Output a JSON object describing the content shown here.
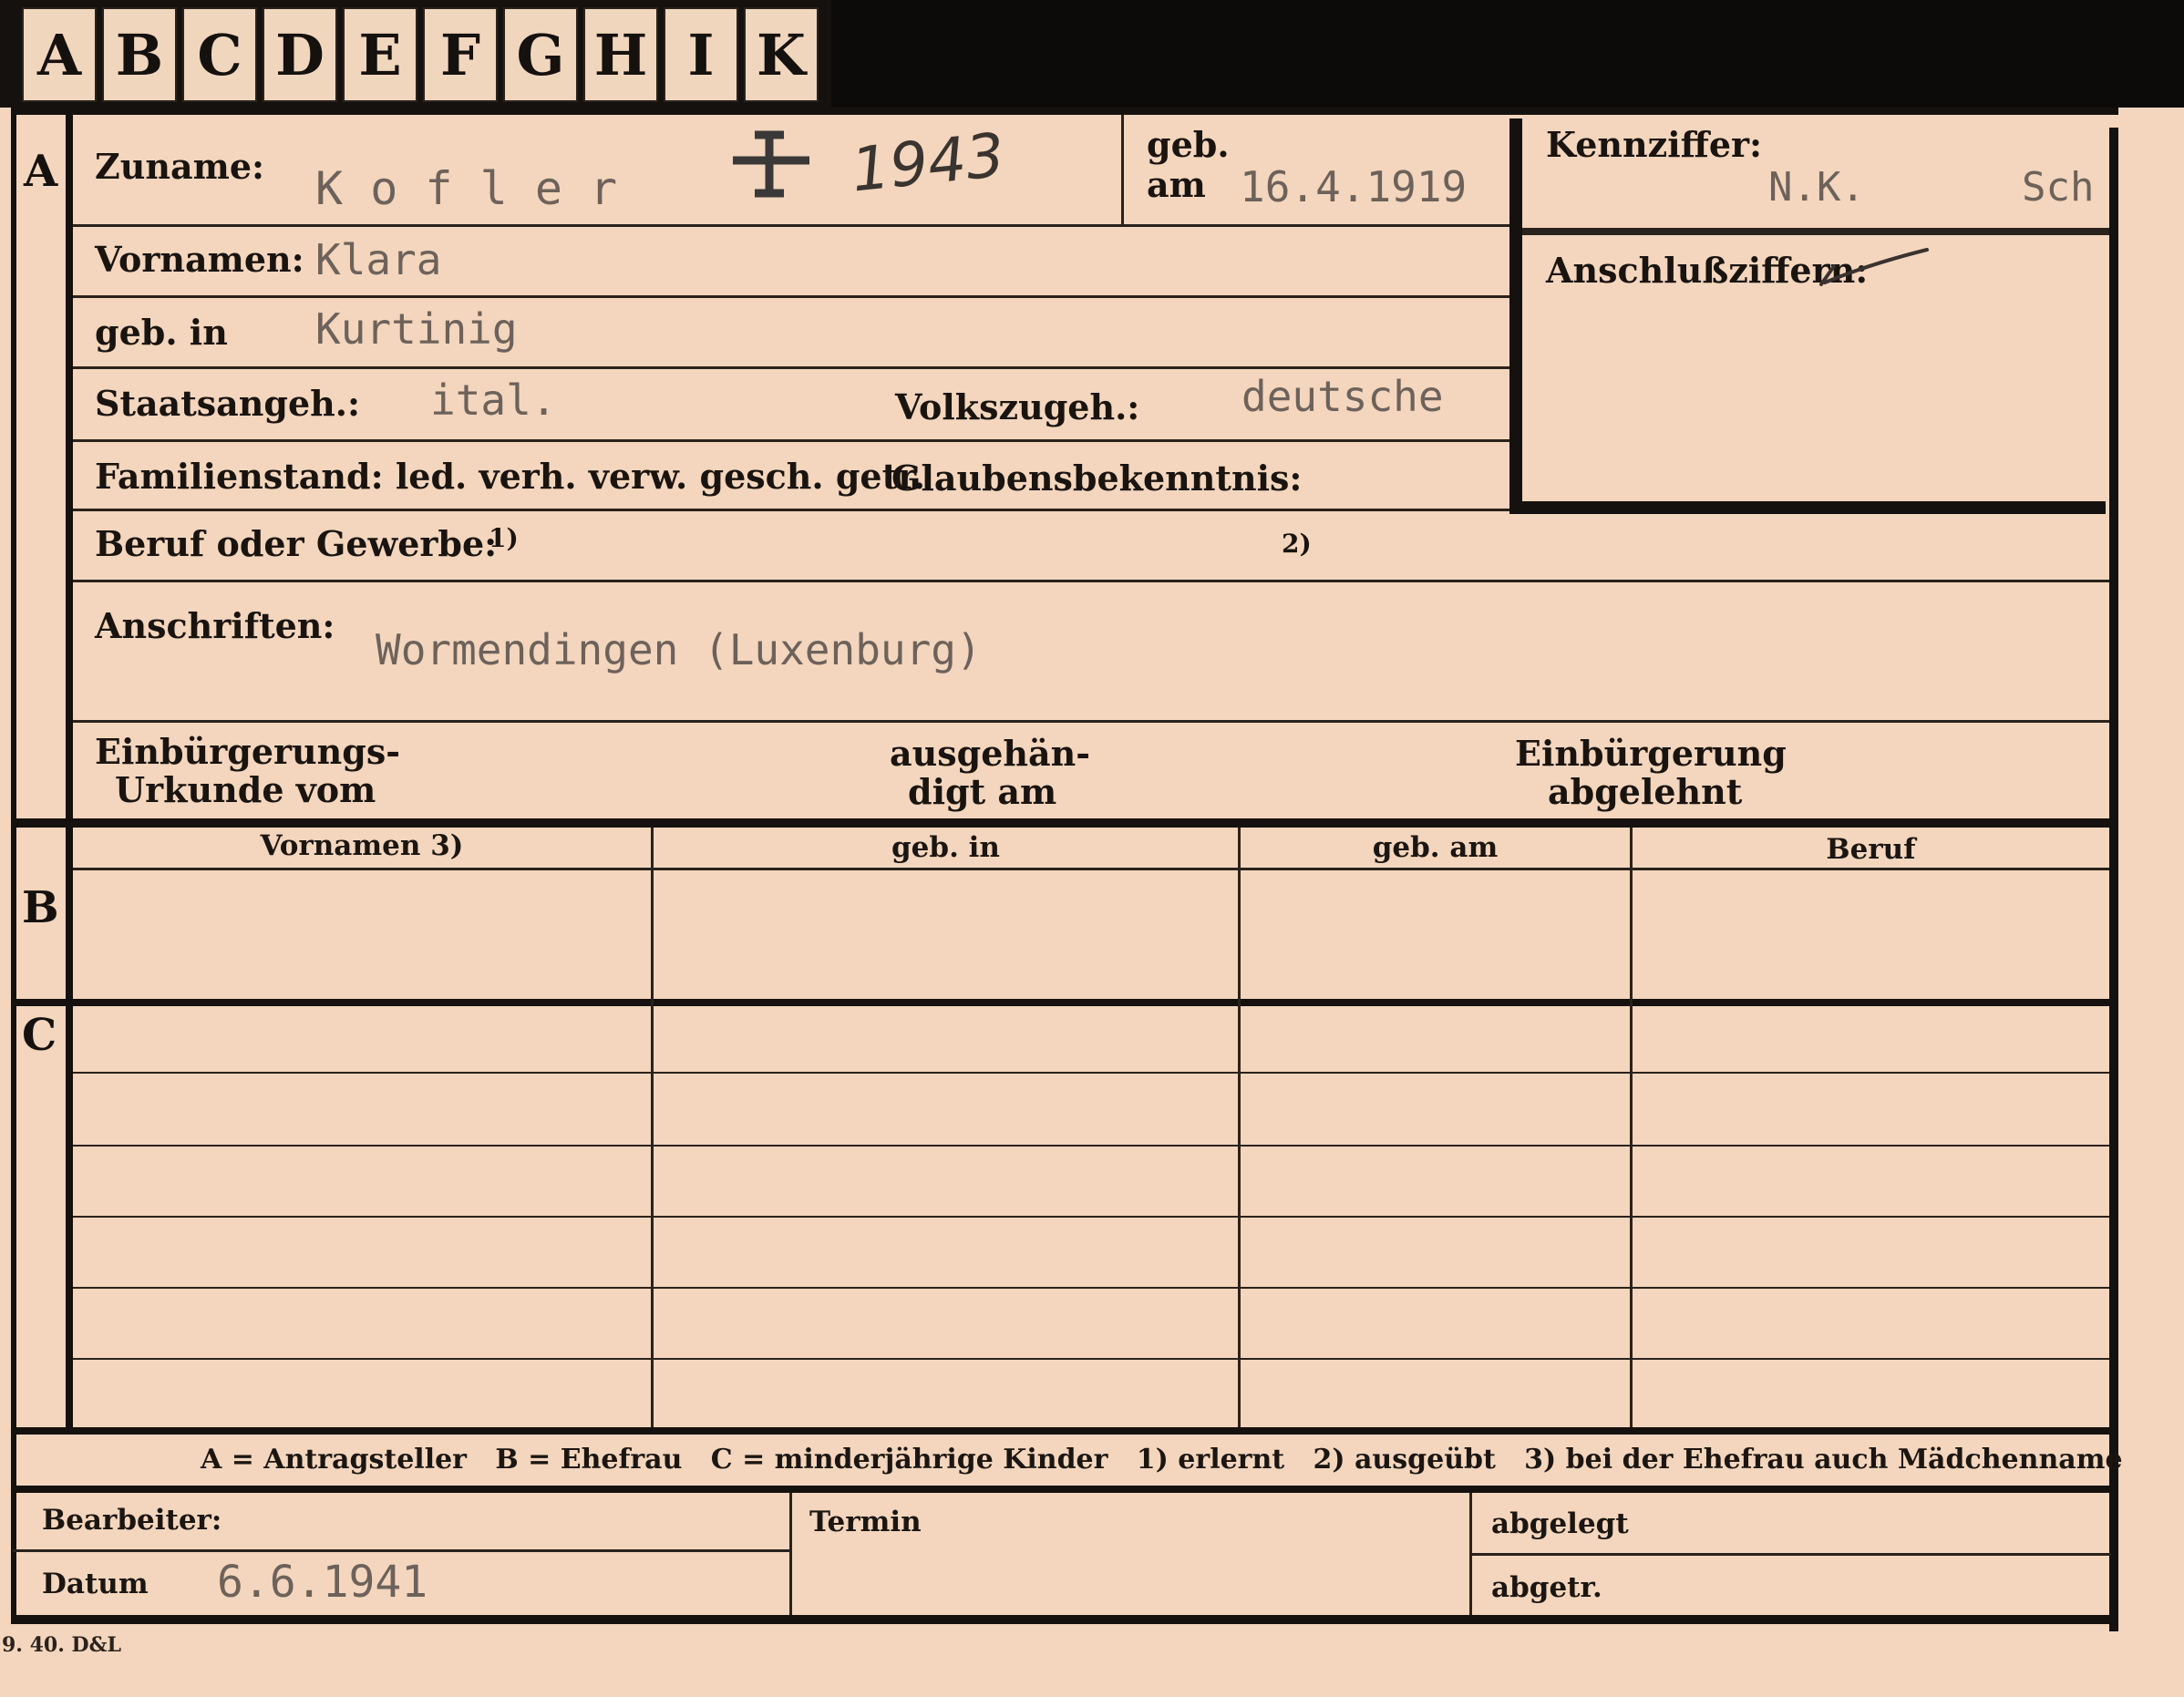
{
  "tabs": [
    "A",
    "B",
    "C",
    "D",
    "E",
    "F",
    "G",
    "H",
    "I",
    "K"
  ],
  "sections": {
    "a": "A",
    "b": "B",
    "c": "C"
  },
  "fields": {
    "zuname_label": "Zuname:",
    "zuname_value": "K o f l e r",
    "cross_note": "1943",
    "geb_label": "geb.",
    "am_label": "am",
    "geb_am_value": "16.4.1919",
    "kennziffer_label": "Kennziffer:",
    "kennziffer_value": "N.K.",
    "kennziffer_value2": "Sch",
    "vornamen_label": "Vornamen:",
    "vornamen_value": "Klara",
    "anschluss_label": "Anschlußziffern:",
    "geb_in_label": "geb. in",
    "geb_in_value": "Kurtinig",
    "staats_label": "Staatsangeh.:",
    "staats_value": "ital.",
    "volks_label": "Volkszugeh.:",
    "volks_value": "deutsche",
    "familien_label": "Familienstand: led. verh. verw. gesch. getr.",
    "glauben_label": "Glaubensbekenntnis:",
    "beruf_label": "Beruf oder Gewerbe:",
    "beruf_note1": "1)",
    "beruf_note2": "2)",
    "anschriften_label": "Anschriften:",
    "anschriften_value": "Wormendingen (Luxenburg)",
    "einb_urk_line1": "Einbürgerungs-",
    "einb_urk_line2": "Urkunde vom",
    "ausgeh_line1": "ausgehän-",
    "ausgeh_line2": "digt am",
    "einb_abg_line1": "Einbürgerung",
    "einb_abg_line2": "abgelehnt"
  },
  "table": {
    "headers": [
      "Vornamen 3)",
      "geb. in",
      "geb. am",
      "Beruf"
    ]
  },
  "legend": "A = Antragsteller   B = Ehefrau   C = minderjährige Kinder   1) erlernt   2) ausgeübt   3) bei der Ehefrau auch Mädchenname",
  "footer": {
    "bearbeiter_label": "Bearbeiter:",
    "datum_label": "Datum",
    "datum_value": "6.6.1941",
    "termin_label": "Termin",
    "abgelegt_label": "abgelegt",
    "abgetr_label": "abgetr."
  },
  "print_code": "9. 40. D&L"
}
